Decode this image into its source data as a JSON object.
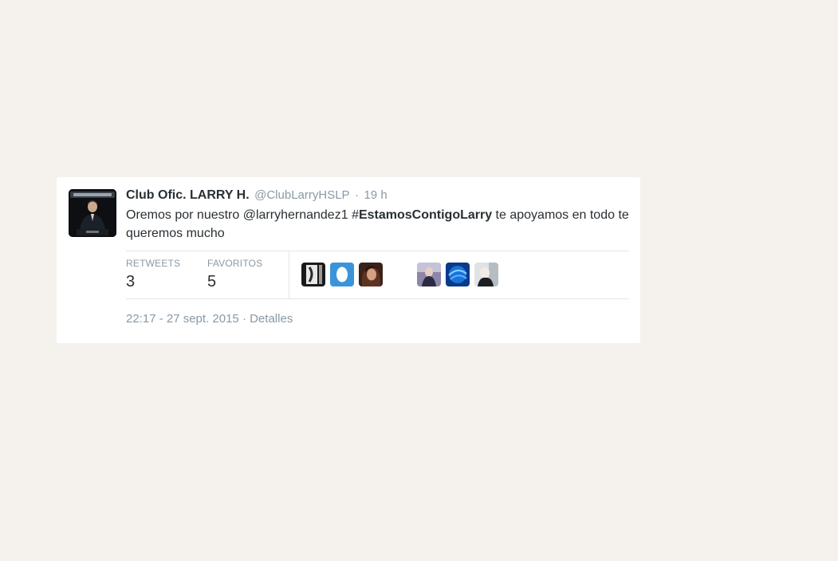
{
  "tweet": {
    "author": {
      "fullname": "Club Ofic. LARRY H.",
      "username": "@ClubLarryHSLP",
      "avatar": "profile-photo"
    },
    "separator": "·",
    "time": "19 h",
    "text": {
      "part1": "Oremos por nuestro ",
      "mention": "@larryhernandez1",
      "space": " ",
      "hash_sign": "#",
      "hashtag": "EstamosContigoLarry",
      "part2": " te apoyamos en todo te queremos mucho"
    },
    "stats": {
      "retweets": {
        "label": "RETWEETS",
        "value": "3"
      },
      "favorites": {
        "label": "FAVORITOS",
        "value": "5"
      }
    },
    "faces": [
      "face-1",
      "face-2",
      "face-3",
      "face-4",
      "face-5",
      "face-6"
    ],
    "footer": {
      "timestamp": "22:17 - 27 sept. 2015",
      "separator": "·",
      "details": "Detalles"
    }
  },
  "colors": {
    "page_background": "#f5f2ed",
    "card_background": "#ffffff",
    "text_primary": "#292f33",
    "text_secondary": "#8899a6",
    "divider": "#e1e8ed",
    "face_2_background": "#3b94d9"
  }
}
